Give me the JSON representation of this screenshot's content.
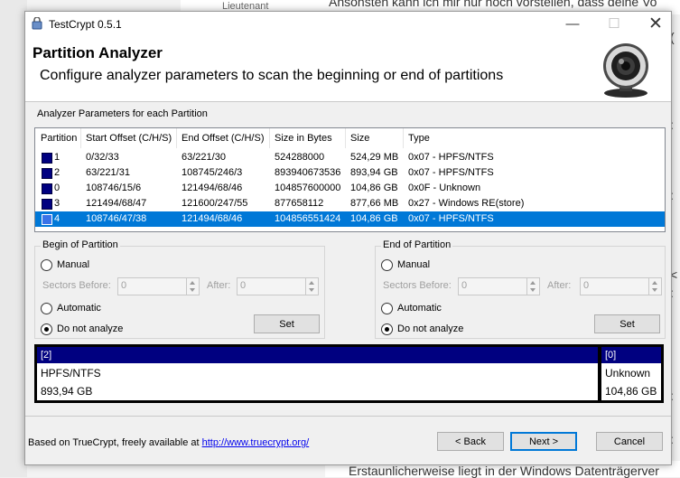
{
  "background": {
    "top_text": "Ansonsten kann ich mir nur noch vorstellen, dass deine Vo",
    "rank": "Lieutenant",
    "bottom_text": "Erstaunlicherweise liegt in der Windows Datenträgerver"
  },
  "window": {
    "title": "TestCrypt 0.5.1",
    "minimize_glyph": "—",
    "maximize_glyph": "☐",
    "close_glyph": "✕"
  },
  "header": {
    "title": "Partition Analyzer",
    "subtitle": "Configure analyzer parameters to scan the beginning or end of partitions"
  },
  "analyzer": {
    "group_label": "Analyzer Parameters for each Partition",
    "columns": [
      "Partition",
      "Start Offset (C/H/S)",
      "End Offset (C/H/S)",
      "Size in Bytes",
      "Size",
      "Type"
    ],
    "rows": [
      {
        "partition": "1",
        "start": "0/32/33",
        "end": "63/221/30",
        "bytes": "524288000",
        "size": "524,29 MB",
        "type": "0x07 - HPFS/NTFS",
        "selected": false
      },
      {
        "partition": "2",
        "start": "63/221/31",
        "end": "108745/246/3",
        "bytes": "893940673536",
        "size": "893,94 GB",
        "type": "0x07 - HPFS/NTFS",
        "selected": false
      },
      {
        "partition": "0",
        "start": "108746/15/6",
        "end": "121494/68/46",
        "bytes": "104857600000",
        "size": "104,86 GB",
        "type": "0x0F - Unknown",
        "selected": false
      },
      {
        "partition": "3",
        "start": "121494/68/47",
        "end": "121600/247/55",
        "bytes": "877658112",
        "size": "877,66 MB",
        "type": "0x27 - Windows RE(store)",
        "selected": false
      },
      {
        "partition": "4",
        "start": "108746/47/38",
        "end": "121494/68/46",
        "bytes": "104856551424",
        "size": "104,86 GB",
        "type": "0x07 - HPFS/NTFS",
        "selected": true
      }
    ]
  },
  "begin_group": {
    "label": "Begin of Partition",
    "manual": "Manual",
    "sectors_before": "Sectors Before:",
    "sectors_before_value": "0",
    "after": "After:",
    "after_value": "0",
    "automatic": "Automatic",
    "do_not_analyze": "Do not analyze",
    "set": "Set"
  },
  "end_group": {
    "label": "End of Partition",
    "manual": "Manual",
    "sectors_before": "Sectors Before:",
    "sectors_before_value": "0",
    "after": "After:",
    "after_value": "0",
    "automatic": "Automatic",
    "do_not_analyze": "Do not analyze",
    "set": "Set"
  },
  "partition_map": [
    {
      "id": "[2]",
      "fs": "HPFS/NTFS",
      "size": "893,94 GB"
    },
    {
      "id": "[0]",
      "fs": "Unknown",
      "size": "104,86 GB"
    }
  ],
  "footer": {
    "text": "Based on TrueCrypt, freely available at",
    "link": "http://www.truecrypt.org/",
    "back": "< Back",
    "next": "Next >",
    "cancel": "Cancel"
  },
  "colors": {
    "selection": "#0078d7",
    "partition_swatch": "#000080"
  },
  "icons": [
    "app-icon",
    "camera-icon",
    "radio-icon",
    "spin-arrows-icon"
  ]
}
